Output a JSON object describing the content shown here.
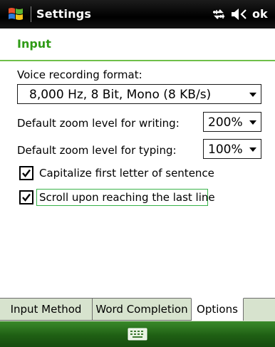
{
  "titlebar": {
    "title": "Settings",
    "ok_label": "ok",
    "icons": [
      "windows-start-icon",
      "connectivity-icon",
      "volume-icon"
    ]
  },
  "header": {
    "title": "Input"
  },
  "form": {
    "voice_label": "Voice recording format:",
    "voice_value": "8,000 Hz, 8 Bit, Mono (8 KB/s)",
    "zoom_writing_label": "Default zoom level for writing:",
    "zoom_writing_value": "200%",
    "zoom_typing_label": "Default zoom level for typing:",
    "zoom_typing_value": "100%",
    "capitalize_label": "Capitalize first letter of sentence",
    "capitalize_checked": true,
    "scroll_label": "Scroll upon reaching the last line",
    "scroll_checked": true
  },
  "tabs": [
    {
      "label": "Input Method",
      "active": false
    },
    {
      "label": "Word Completion",
      "active": false
    },
    {
      "label": "Options",
      "active": true
    }
  ],
  "bottombar": {
    "icon": "keyboard-icon"
  },
  "colors": {
    "accent_green": "#2f9b15",
    "bar_green": "#1f5f14",
    "tab_bg": "#d7e3ce"
  }
}
